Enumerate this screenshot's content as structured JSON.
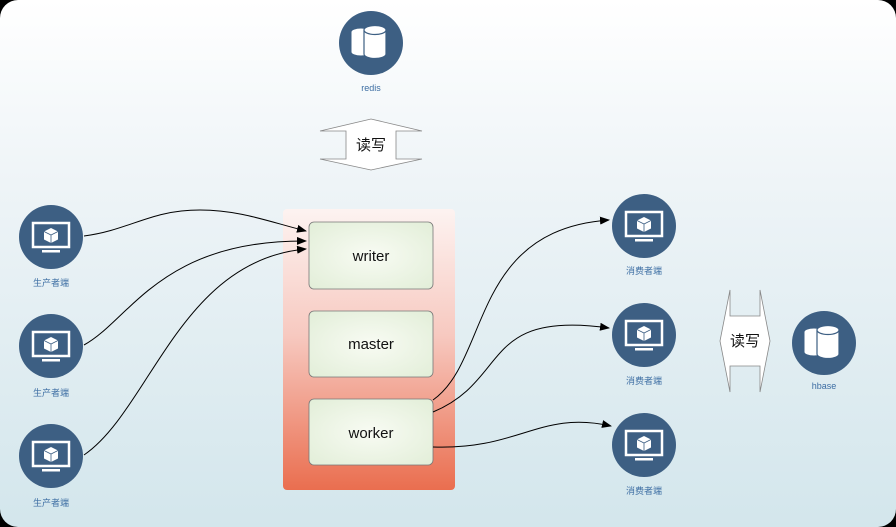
{
  "redis": {
    "label": "redis",
    "icon": "database-icon"
  },
  "hbase": {
    "label": "hbase",
    "icon": "database-icon"
  },
  "redis_rw": "读写",
  "hbase_rw": "读写",
  "producers": [
    {
      "label": "生产者端",
      "icon": "monitor-cube-icon"
    },
    {
      "label": "生产者端",
      "icon": "monitor-cube-icon"
    },
    {
      "label": "生产者端",
      "icon": "monitor-cube-icon"
    }
  ],
  "consumers": [
    {
      "label": "消费者端",
      "icon": "monitor-cube-icon"
    },
    {
      "label": "消费者端",
      "icon": "monitor-cube-icon"
    },
    {
      "label": "消费者端",
      "icon": "monitor-cube-icon"
    }
  ],
  "modules": {
    "writer": "writer",
    "master": "master",
    "worker": "worker"
  },
  "colors": {
    "node": "#3d5f83",
    "label": "#3d6ea3",
    "container_bottom": "#ea6e4f",
    "module_fill": "#e8f2de"
  }
}
